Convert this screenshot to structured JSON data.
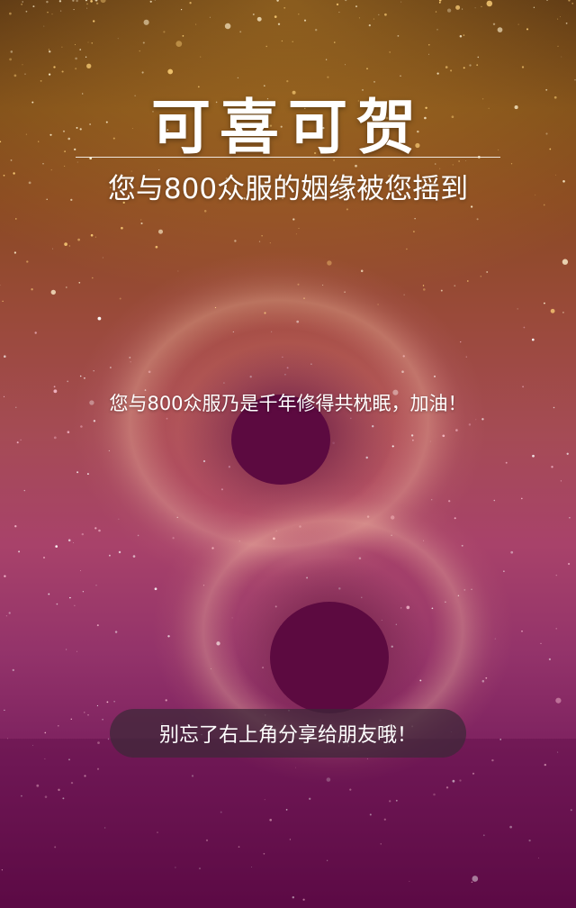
{
  "header": {
    "title": "可喜可贺",
    "subtitle": "您与800众服的姻缘被您摇到"
  },
  "main": {
    "message": "您与800众服乃是千年修得共枕眠，加油！"
  },
  "footer": {
    "share_hint": "别忘了右上角分享给朋友哦！"
  },
  "colors": {
    "top_gold": "#7a4a18",
    "mid_rose": "#a54b55",
    "bottom_plum": "#5e0b47",
    "hole": "#5c0a40",
    "pill_bg": "#3c2837"
  }
}
